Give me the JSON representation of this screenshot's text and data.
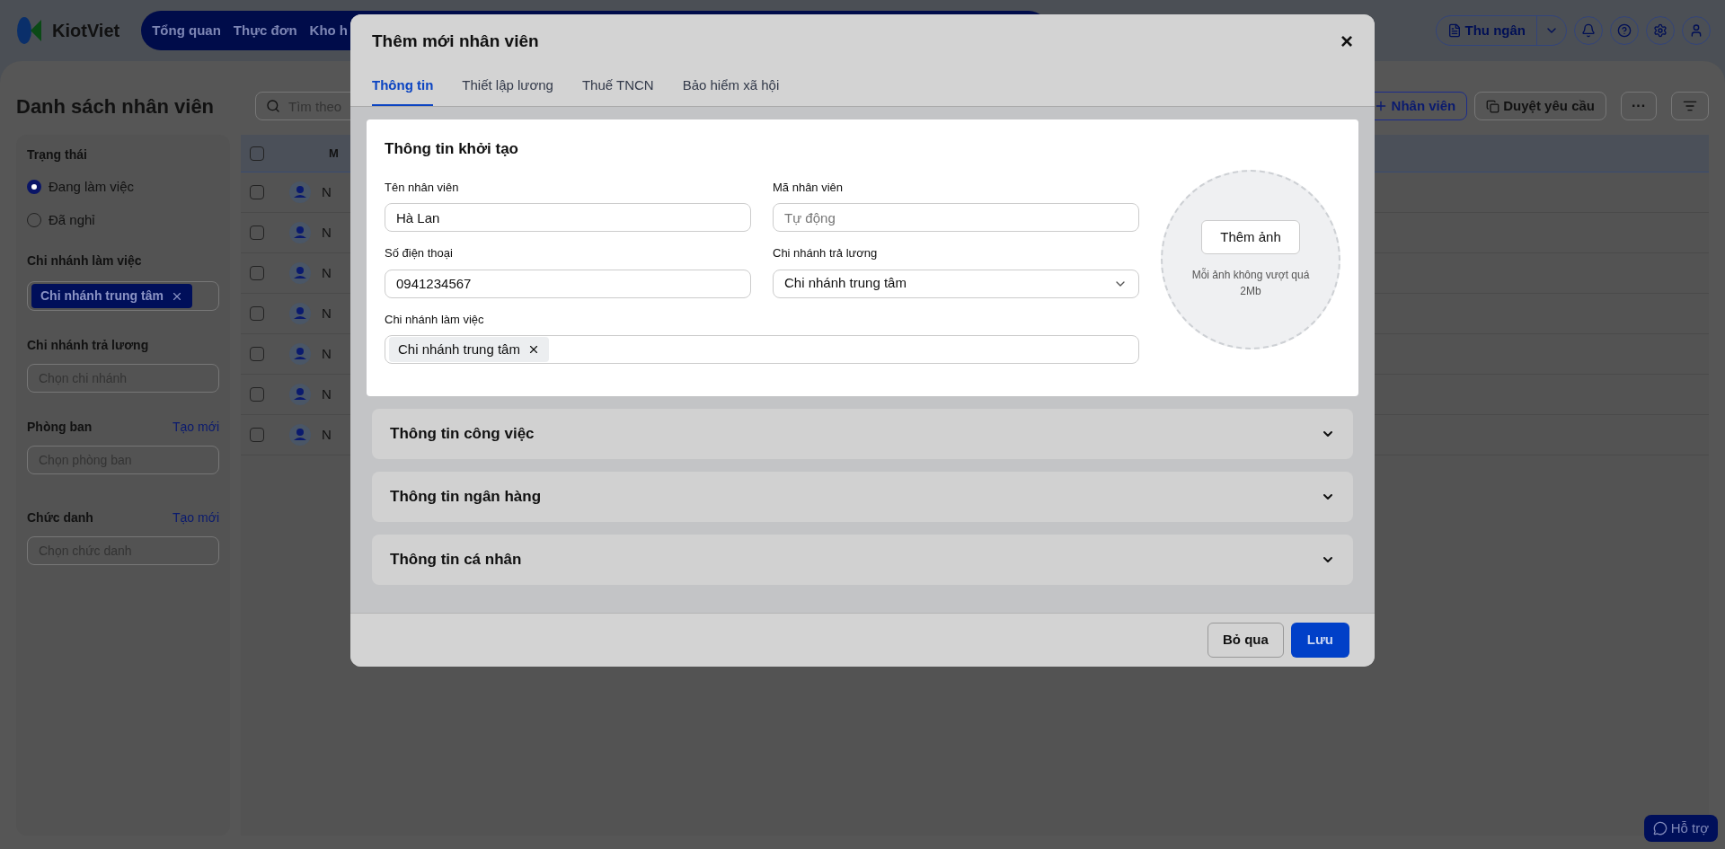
{
  "app": {
    "logo": "KiotViet",
    "nav": [
      "Tổng quan",
      "Thực đơn",
      "Kho h"
    ],
    "cashier": "Thu ngân"
  },
  "page": {
    "title": "Danh sách nhân viên",
    "search_placeholder": "Tìm theo",
    "actions": {
      "add": "Nhân viên",
      "approve": "Duyệt yêu cầu",
      "more": "···"
    }
  },
  "filters": {
    "status_label": "Trạng thái",
    "status": [
      {
        "label": "Đang làm việc",
        "selected": true
      },
      {
        "label": "Đã nghỉ",
        "selected": false
      }
    ],
    "work_branch_label": "Chi nhánh làm việc",
    "work_branch_tags": [
      "Chi nhánh trung tâm"
    ],
    "pay_branch_label": "Chi nhánh trả lương",
    "pay_branch_placeholder": "Chọn chi nhánh",
    "department_label": "Phòng ban",
    "department_link": "Tạo mới",
    "department_placeholder": "Chọn phòng ban",
    "title_label": "Chức danh",
    "title_link": "Tạo mới",
    "title_placeholder": "Chọn chức danh"
  },
  "table": {
    "columns": [
      "M"
    ],
    "header_checked": false,
    "rows": [
      {
        "checked": false,
        "cell": "N"
      },
      {
        "checked": false,
        "cell": "N"
      },
      {
        "checked": false,
        "cell": "N"
      },
      {
        "checked": false,
        "cell": "N"
      },
      {
        "checked": false,
        "cell": "N"
      },
      {
        "checked": false,
        "cell": "N"
      },
      {
        "checked": false,
        "cell": "N"
      }
    ]
  },
  "support": "Hỗ trợ",
  "dialog": {
    "title": "Thêm mới nhân viên",
    "close": "×",
    "tabs": [
      {
        "label": "Thông tin",
        "selected": true
      },
      {
        "label": "Thiết lập lương",
        "selected": false
      },
      {
        "label": "Thuế TNCN",
        "selected": false
      },
      {
        "label": "Bảo hiểm xã hội",
        "selected": false
      }
    ],
    "section": {
      "title": "Thông tin khởi tạo",
      "name": {
        "label": "Tên nhân viên",
        "value": "Hà Lan"
      },
      "code": {
        "label": "Mã nhân viên",
        "placeholder": "Tự động"
      },
      "phone": {
        "label": "Số điện thoại",
        "value": "0941234567"
      },
      "pay_branch": {
        "label": "Chi nhánh trả lương",
        "value": "Chi nhánh trung tâm"
      },
      "work_branch": {
        "label": "Chi nhánh làm việc",
        "tags": [
          "Chi nhánh trung tâm"
        ]
      },
      "photo": {
        "button": "Thêm ảnh",
        "hint": "Mỗi ảnh không vượt quá 2Mb"
      }
    },
    "accordions": [
      {
        "title": "Thông tin công việc",
        "expanded": false
      },
      {
        "title": "Thông tin ngân hàng",
        "expanded": false
      },
      {
        "title": "Thông tin cá nhân",
        "expanded": false
      }
    ],
    "buttons": {
      "cancel": "Bỏ qua",
      "save": "Lưu"
    }
  }
}
